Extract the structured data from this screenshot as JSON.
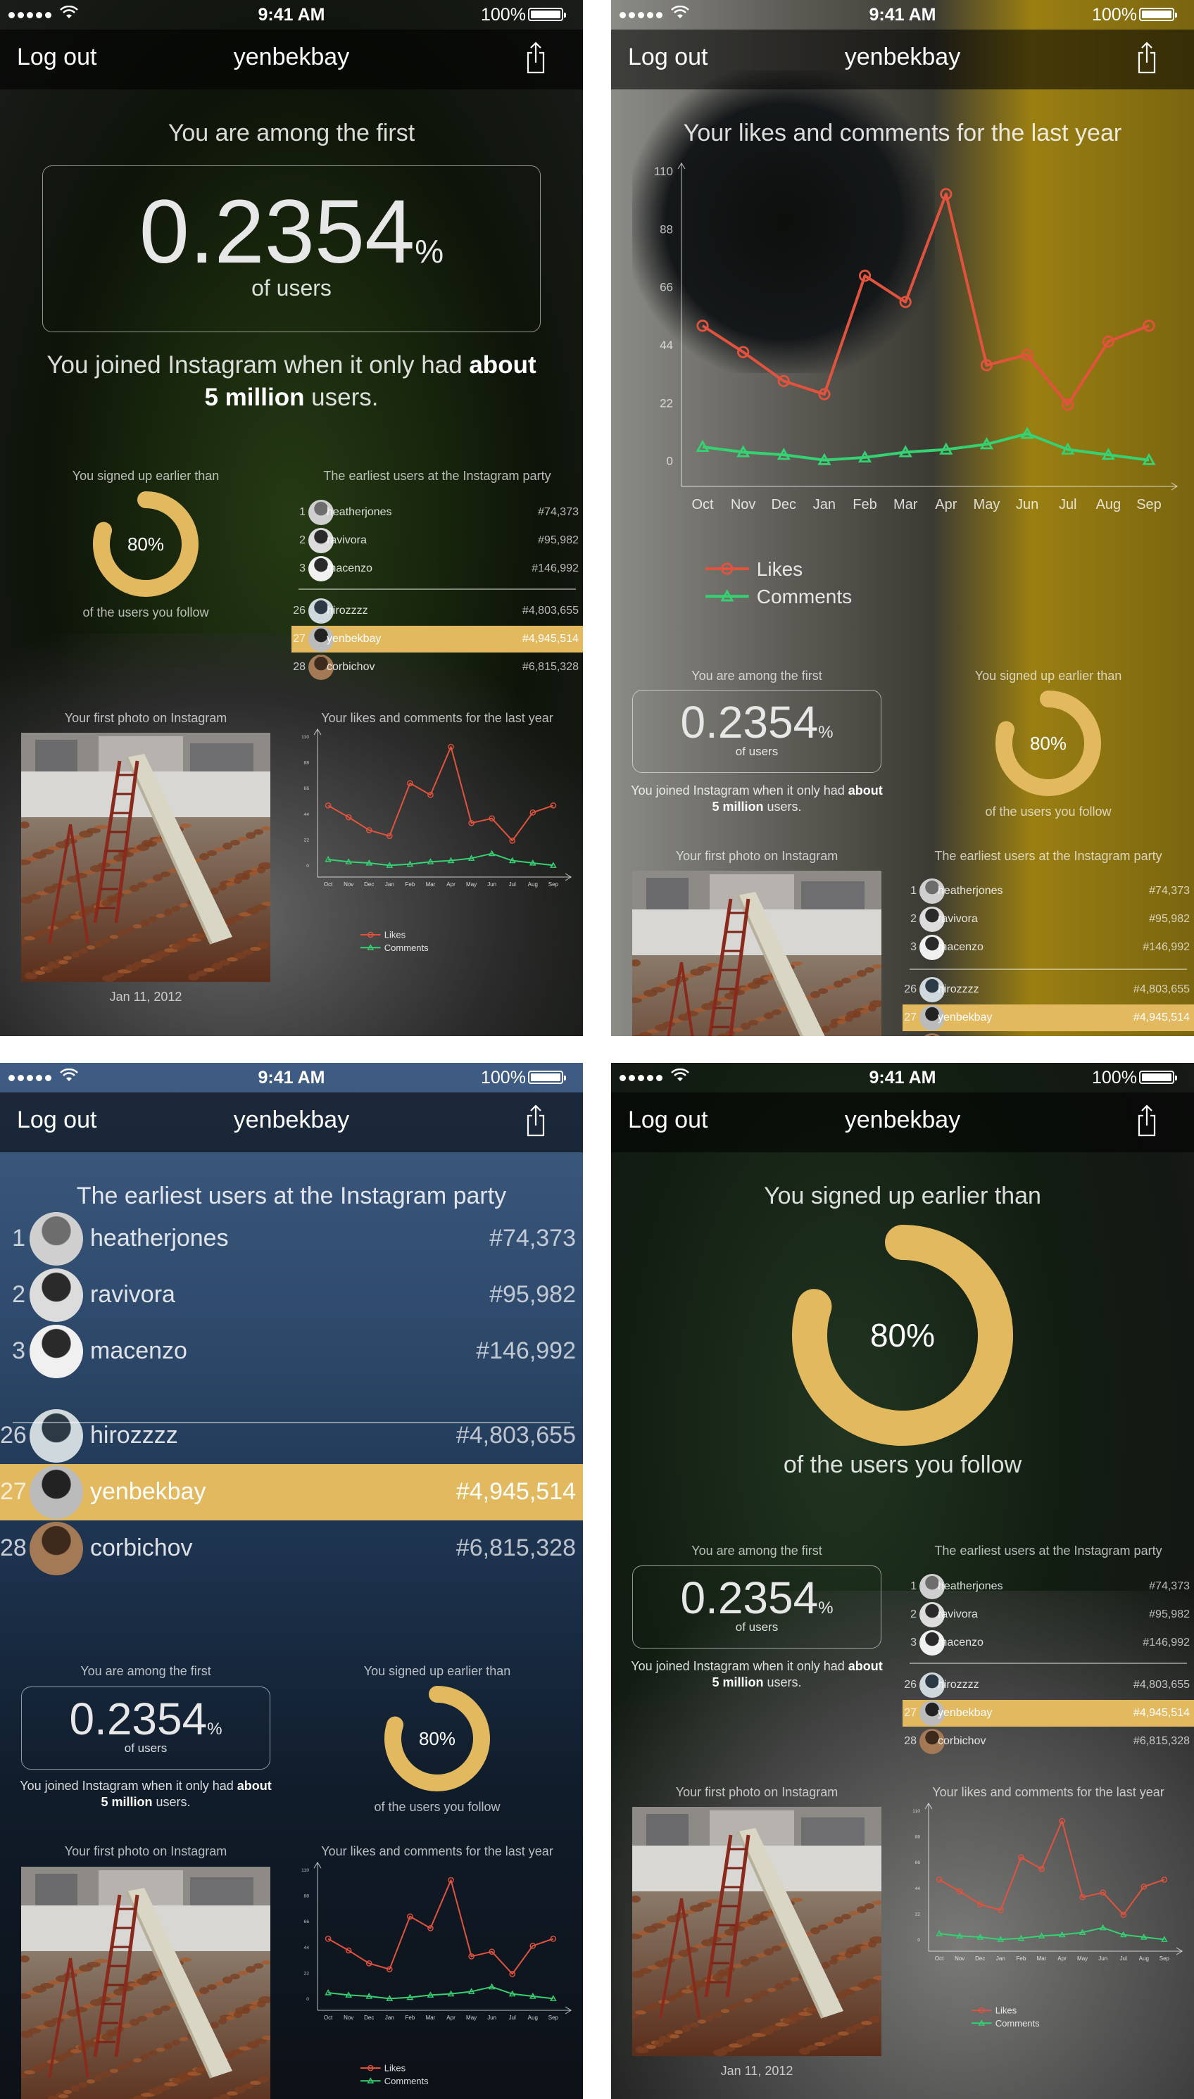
{
  "status": {
    "time": "9:41 AM",
    "battery": "100%"
  },
  "nav": {
    "logout": "Log out",
    "username": "yenbekbay"
  },
  "first": {
    "heading": "You are among the first",
    "number": "0.2354",
    "percent_sign": "%",
    "of_users": "of users",
    "joined_pre": "You joined Instagram when it only had ",
    "joined_bold1": "about",
    "joined_bold2": "5 million",
    "joined_post": " users."
  },
  "signup": {
    "heading": "You signed up earlier than",
    "value": "80%",
    "fraction": 0.8,
    "footer": "of the users you follow"
  },
  "party": {
    "heading": "The earliest users at the Instagram party",
    "top": [
      {
        "n": "1",
        "name": "heatherjones",
        "rank": "#74,373"
      },
      {
        "n": "2",
        "name": "ravivora",
        "rank": "#95,982"
      },
      {
        "n": "3",
        "name": "macenzo",
        "rank": "#146,992"
      }
    ],
    "near": [
      {
        "n": "26",
        "name": "hirozzzz",
        "rank": "#4,803,655"
      },
      {
        "n": "27",
        "name": "yenbekbay",
        "rank": "#4,945,514"
      },
      {
        "n": "28",
        "name": "corbichov",
        "rank": "#6,815,328"
      }
    ]
  },
  "photo": {
    "heading": "Your first photo on Instagram",
    "date": "Jan 11, 2012"
  },
  "chart_data": {
    "type": "line",
    "title": "Your likes and comments for the last year",
    "categories": [
      "Oct",
      "Nov",
      "Dec",
      "Jan",
      "Feb",
      "Mar",
      "Apr",
      "May",
      "Jun",
      "Jul",
      "Aug",
      "Sep"
    ],
    "yticks": [
      0,
      22,
      44,
      66,
      88,
      110
    ],
    "ylim": [
      -10,
      110
    ],
    "series": [
      {
        "name": "Likes",
        "color": "#e2533e",
        "values": [
          51,
          41,
          30,
          25,
          70,
          60,
          101,
          36,
          40,
          21,
          45,
          51
        ]
      },
      {
        "name": "Comments",
        "color": "#35d172",
        "values": [
          5,
          3,
          2,
          0,
          1,
          3,
          4,
          6,
          10,
          4,
          2,
          0
        ]
      }
    ],
    "legend_position": "bottom-left"
  }
}
